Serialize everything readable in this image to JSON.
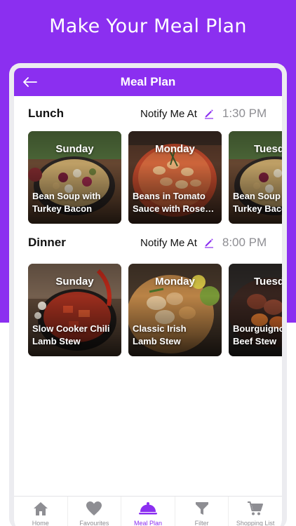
{
  "promo": {
    "title": "Make Your Meal Plan"
  },
  "colors": {
    "accent": "#8b2ff0",
    "inactive": "#8e8e93"
  },
  "header": {
    "title": "Meal Plan",
    "back_icon": "arrow-left-icon"
  },
  "sections": [
    {
      "title": "Lunch",
      "notify_label": "Notify Me At",
      "time": "1:30 PM",
      "cards": [
        {
          "day": "Sunday",
          "name": "Bean Soup with\nTurkey Bacon"
        },
        {
          "day": "Monday",
          "name": "Beans in Tomato\nSauce with Rose…"
        },
        {
          "day": "Tuesd",
          "name": "Bean Soup\nTurkey Baco"
        }
      ]
    },
    {
      "title": "Dinner",
      "notify_label": "Notify Me At",
      "time": "8:00 PM",
      "cards": [
        {
          "day": "Sunday",
          "name": "Slow Cooker Chili\nLamb Stew"
        },
        {
          "day": "Monday",
          "name": "Classic Irish\nLamb Stew"
        },
        {
          "day": "Tuesd",
          "name": "Bourguigno\nBeef Stew"
        }
      ]
    }
  ],
  "tabs": [
    {
      "label": "Home",
      "icon": "home-icon"
    },
    {
      "label": "Favourites",
      "icon": "heart-icon"
    },
    {
      "label": "Meal Plan",
      "icon": "dish-cover-icon",
      "active": true
    },
    {
      "label": "Filter",
      "icon": "filter-icon"
    },
    {
      "label": "Shopping List",
      "icon": "cart-icon"
    }
  ]
}
